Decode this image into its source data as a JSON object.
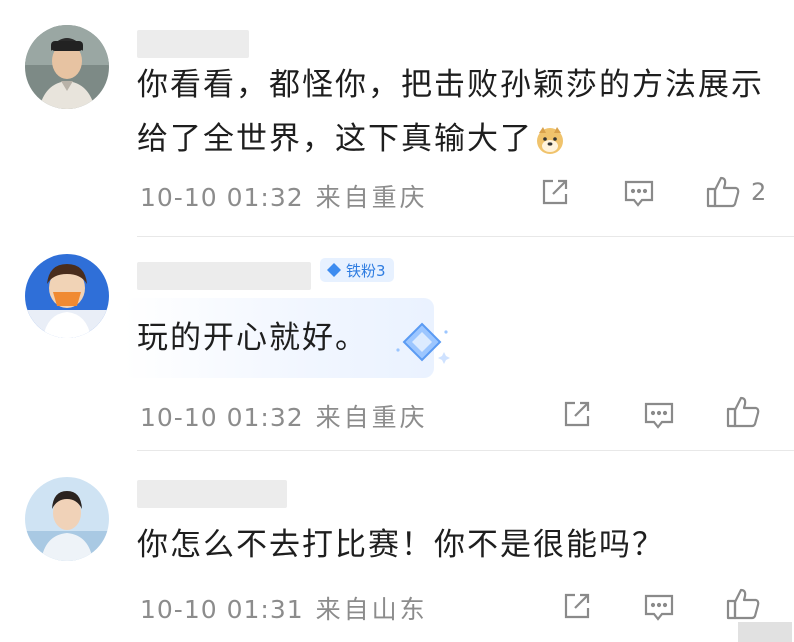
{
  "comments": [
    {
      "text_line1": "你看看，都怪你，把击败孙颖莎的方法展示",
      "text_line2": "给了全世界，这下真输大了",
      "emoji_icon": "doge-emoji",
      "time": "10-10 01:32",
      "location": "来自重庆",
      "like_count": "2"
    },
    {
      "badge": "铁粉3",
      "text": "玩的开心就好。",
      "time": "10-10 01:32",
      "location": "来自重庆"
    },
    {
      "text": "你怎么不去打比赛！你不是很能吗？",
      "time": "10-10 01:31",
      "location": "来自山东"
    }
  ],
  "icons": {
    "share": "share-icon",
    "comment": "comment-icon",
    "like": "thumbs-up-icon"
  },
  "colors": {
    "text": "#1e1e1e",
    "meta": "#8c8c8c",
    "badge_bg": "#e7f1ff",
    "badge_text": "#2f7de1",
    "divider": "#e8e8e8"
  }
}
